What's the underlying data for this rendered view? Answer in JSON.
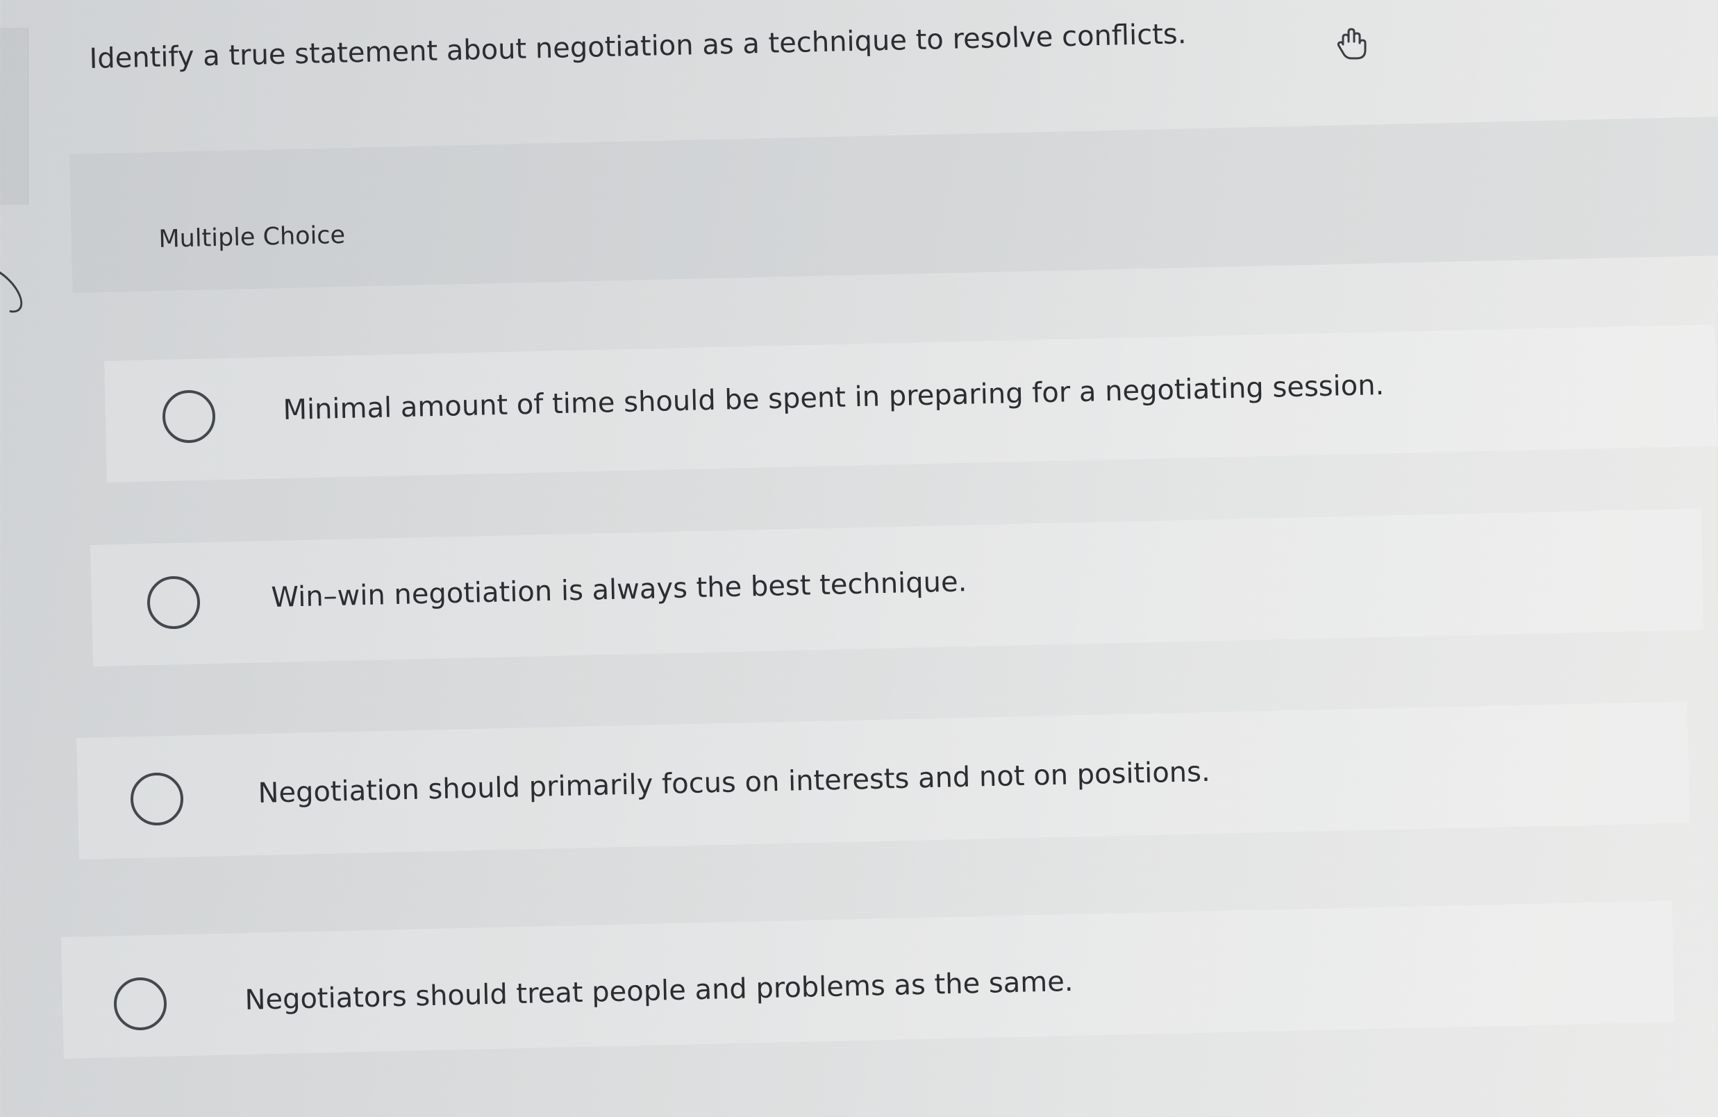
{
  "question": {
    "text": "Identify a true statement about negotiation as a technique to resolve conflicts."
  },
  "section_label": "Multiple Choice",
  "choices": [
    {
      "label": "Minimal amount of time should be spent in preparing for a negotiating session.",
      "selected": false
    },
    {
      "label": "Win–win negotiation is always the best technique.",
      "selected": false
    },
    {
      "label": "Negotiation should primarily focus on interests and not on positions.",
      "selected": false
    },
    {
      "label": "Negotiators should treat people and problems as the same.",
      "selected": false
    }
  ],
  "icons": {
    "pointer": "hand-pointer-icon",
    "radio": "radio-button-icon"
  }
}
